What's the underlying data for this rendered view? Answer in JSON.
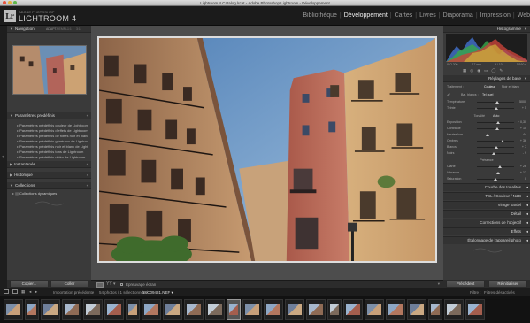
{
  "window": {
    "title": "Lightroom 4 Catalog.lrcat - Adobe Photoshop Lightroom - Développement"
  },
  "identity": {
    "small": "ADOBE PHOTOSHOP",
    "big": "LIGHTROOM 4",
    "logo": "Lr"
  },
  "modules": [
    {
      "label": "Bibliothèque",
      "active": false
    },
    {
      "label": "Développement",
      "active": true
    },
    {
      "label": "Cartes",
      "active": false
    },
    {
      "label": "Livres",
      "active": false
    },
    {
      "label": "Diaporama",
      "active": false
    },
    {
      "label": "Impression",
      "active": false
    },
    {
      "label": "Web",
      "active": false
    }
  ],
  "left": {
    "navigator": {
      "title": "Navigation",
      "zoom_opts": [
        "ADAPT.",
        "REMPL.",
        "1:1",
        "3:1"
      ]
    },
    "presets": {
      "title": "Paramètres prédéfinis",
      "items": [
        "Paramètres prédéfinis couleur de Lightroom",
        "Paramètres prédéfinis d'effets de Lightroom",
        "Paramètres prédéfinis de filtres noir et blanc",
        "Paramètres prédéfinis généraux de Lightroom",
        "Paramètres prédéfinis noir et blanc de Lightroom",
        "Paramètres prédéfinis tons de Lightroom",
        "Paramètres prédéfinis vidéo de Lightroom",
        "Paramètres prédéfinis de l'utilisateur"
      ]
    },
    "snapshots": {
      "title": "Instantanés"
    },
    "history": {
      "title": "Historique"
    },
    "collections": {
      "title": "Collections",
      "item": "Collections dynamiques"
    },
    "copy_label": "Copier...",
    "paste_label": "Coller"
  },
  "toolbar": {
    "softproof": "Épreuvage écran"
  },
  "filmbar": {
    "import": "Importation précédente",
    "count": "54 photos / 1 sélectionnée /",
    "filename": "DSC09481.NEF ▾",
    "filter_label": "Filtre :",
    "filter_value": "Filtres désactivés"
  },
  "right": {
    "histogram": {
      "title": "Histogramme",
      "iso": "ISO 200",
      "focal": "17 mm",
      "aperture": "f / 10",
      "shutter": "1/160 s"
    },
    "basic": {
      "title": "Réglages de base",
      "treatment_label": "Traitement :",
      "treatment_options": [
        "Couleur",
        "Noir et blanc"
      ],
      "wb_label": "Bal. blancs :",
      "wb_value": "Tel quel",
      "tone_label": "Tonalité",
      "tone_auto": "Auto",
      "presence_label": "Présence",
      "sliders": [
        {
          "label": "Température",
          "value": "5000",
          "pos": 0.55
        },
        {
          "label": "Teinte",
          "value": "+ 5",
          "pos": 0.52
        },
        {
          "label": "Exposition",
          "value": "+ 0,30",
          "pos": 0.56
        },
        {
          "label": "Contraste",
          "value": "+ 10",
          "pos": 0.55
        },
        {
          "label": "Hautes lum.",
          "value": "- 44",
          "pos": 0.28
        },
        {
          "label": "Ombres",
          "value": "+ 36",
          "pos": 0.68
        },
        {
          "label": "Blancs",
          "value": "+ 7",
          "pos": 0.53
        },
        {
          "label": "Noirs",
          "value": "- 9",
          "pos": 0.46
        },
        {
          "label": "Clarté",
          "value": "+ 26",
          "pos": 0.63
        },
        {
          "label": "Vibrance",
          "value": "+ 12",
          "pos": 0.56
        },
        {
          "label": "Saturation",
          "value": "0",
          "pos": 0.5
        }
      ]
    },
    "sections": [
      "Courbe des tonalités",
      "TSL / Couleur / N&B",
      "Virage partiel",
      "Détail",
      "Corrections de l'objectif",
      "Effets",
      "Étalonnage de l'appareil photo"
    ],
    "previous_label": "Précédent",
    "reset_label": "Réinitialiser"
  },
  "colors": {
    "accent": "#f0f0f0",
    "panel": "#3a3a3a",
    "bg": "#262626"
  }
}
